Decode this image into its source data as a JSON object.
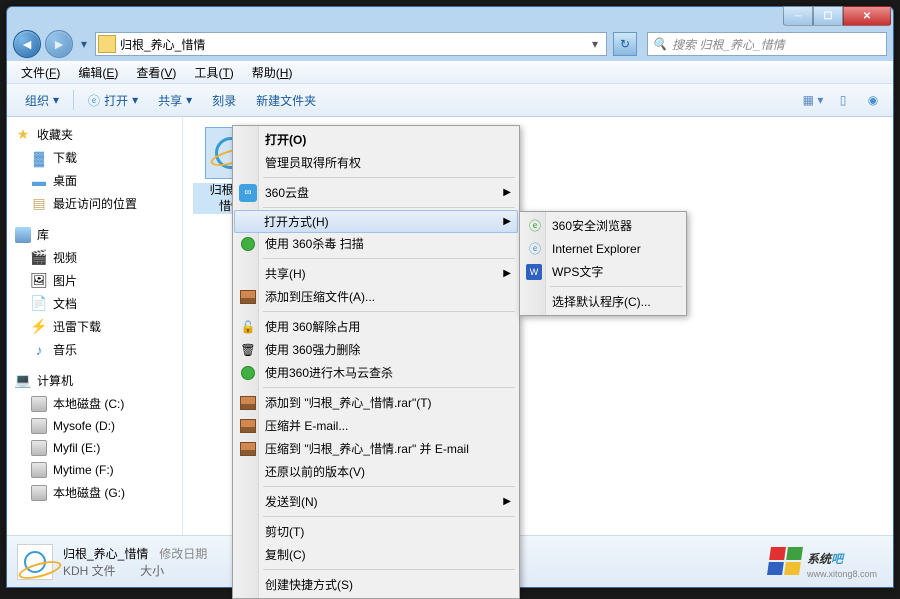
{
  "window": {
    "path": "归根_养心_惜情",
    "search_placeholder": "搜索 归根_养心_惜情"
  },
  "menubar": [
    {
      "label": "文件",
      "key": "F"
    },
    {
      "label": "编辑",
      "key": "E"
    },
    {
      "label": "查看",
      "key": "V"
    },
    {
      "label": "工具",
      "key": "T"
    },
    {
      "label": "帮助",
      "key": "H"
    }
  ],
  "toolbar": {
    "organize": "组织",
    "open": "打开",
    "share": "共享",
    "burn": "刻录",
    "new_folder": "新建文件夹"
  },
  "sidebar": {
    "favorites": {
      "label": "收藏夹",
      "items": [
        "下载",
        "桌面",
        "最近访问的位置"
      ]
    },
    "libraries": {
      "label": "库",
      "items": [
        "视频",
        "图片",
        "文档",
        "迅雷下载",
        "音乐"
      ]
    },
    "computer": {
      "label": "计算机",
      "items": [
        "本地磁盘 (C:)",
        "Mysofe (D:)",
        "Myfil (E:)",
        "Mytime (F:)",
        "本地磁盘 (G:)"
      ]
    }
  },
  "file": {
    "name": "归根_养心_惜情",
    "name_wrapped_1": "归根_养",
    "name_wrapped_2": "惜情"
  },
  "context_menu": {
    "open": "打开(O)",
    "run_as_admin": "管理员取得所有权",
    "cloud360": "360云盘",
    "open_with": "打开方式(H)",
    "scan360": "使用 360杀毒 扫描",
    "share": "共享(H)",
    "add_archive": "添加到压缩文件(A)...",
    "unlock360": "使用 360解除占用",
    "force_del360": "使用 360强力删除",
    "trojan360": "使用360进行木马云查杀",
    "add_rar": "添加到 \"归根_养心_惜情.rar\"(T)",
    "email_rar": "压缩并 E-mail...",
    "email_rar_named": "压缩到 \"归根_养心_惜情.rar\" 并 E-mail",
    "restore": "还原以前的版本(V)",
    "send_to": "发送到(N)",
    "cut": "剪切(T)",
    "copy": "复制(C)",
    "shortcut": "创建快捷方式(S)"
  },
  "submenu": {
    "browser360": "360安全浏览器",
    "ie": "Internet Explorer",
    "wps": "WPS文字",
    "choose_default": "选择默认程序(C)..."
  },
  "statusbar": {
    "filename": "归根_养心_惜情",
    "filetype": "KDH 文件",
    "mod_label": "修改日期",
    "size_label": "大小"
  },
  "watermark": {
    "text": "系统",
    "url": "www.xitong8.com"
  }
}
